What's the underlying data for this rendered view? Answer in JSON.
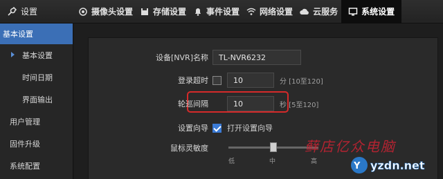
{
  "brand": {
    "label": "设置",
    "icon": "wrench-icon"
  },
  "tabs": [
    {
      "label": "摄像头设置",
      "icon": "camera-icon"
    },
    {
      "label": "存储设置",
      "icon": "floppy-icon"
    },
    {
      "label": "事件设置",
      "icon": "bell-icon"
    },
    {
      "label": "网络设置",
      "icon": "wifi-icon"
    },
    {
      "label": "云服务",
      "icon": "cloud-icon"
    },
    {
      "label": "系统设置",
      "icon": "monitor-icon",
      "active": true
    }
  ],
  "sidebar": {
    "header": "基本设置",
    "items": [
      {
        "label": "基本设置",
        "selected": true
      },
      {
        "label": "时间日期"
      },
      {
        "label": "界面输出"
      },
      {
        "label": "用户管理"
      },
      {
        "label": "固件升级"
      },
      {
        "label": "系统配置"
      }
    ]
  },
  "form": {
    "device_name_label": "设备[NVR]名称",
    "device_name_value": "TL-NVR6232",
    "login_timeout_label": "登录超时",
    "login_timeout_value": "10",
    "login_timeout_hint": "分 [10至120]",
    "patrol_interval_label": "轮巡间隔",
    "patrol_interval_value": "10",
    "patrol_interval_hint": "秒 [5至120]",
    "wizard_label": "设置向导",
    "wizard_checkbox_label": "打开设置向导",
    "mouse_sensitivity_label": "鼠标灵敏度",
    "slider_ticks": [
      "低",
      "中",
      "高"
    ],
    "mouse_sensitivity_level": 0.5
  },
  "watermark": {
    "text": "藓店亿众电脑",
    "subtext": "yzdn.net"
  },
  "colors": {
    "accent": "#3b6fb6",
    "highlight": "#d62a2a"
  }
}
